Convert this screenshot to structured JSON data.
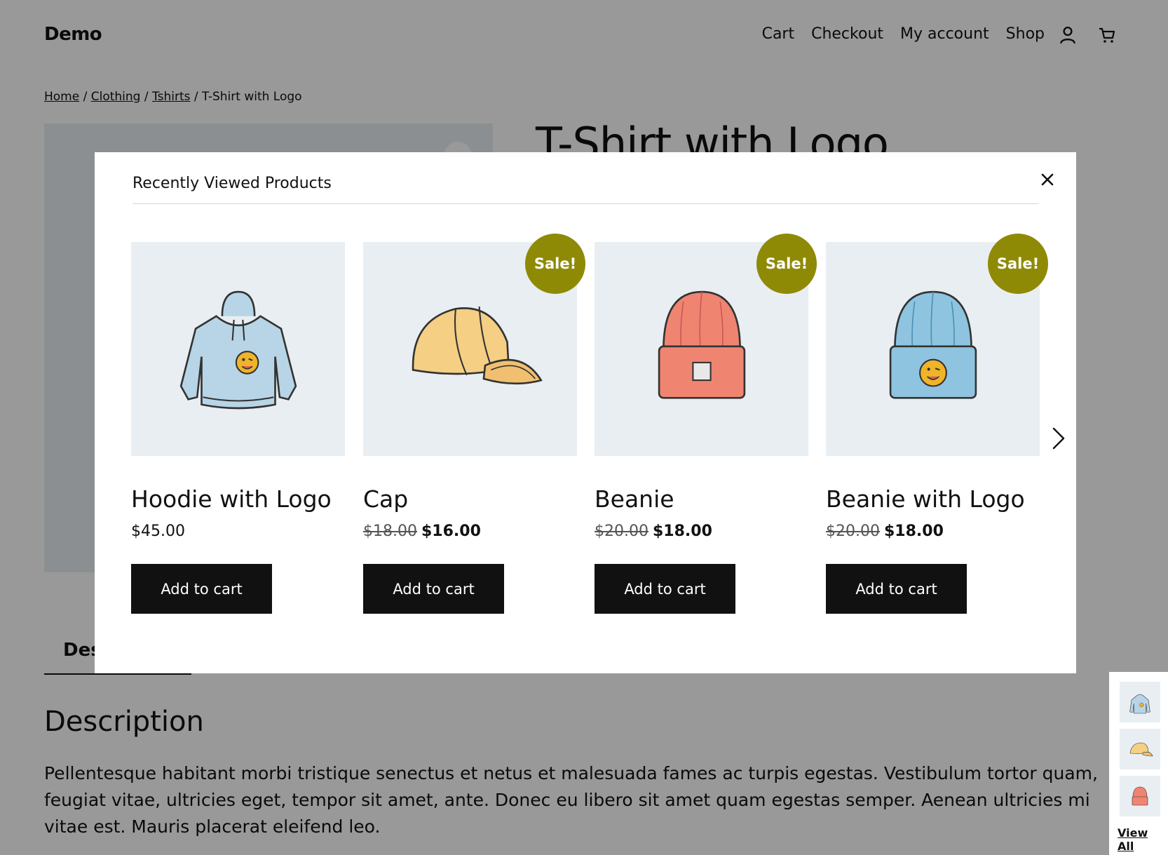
{
  "header": {
    "site_title": "Demo",
    "nav": [
      "Cart",
      "Checkout",
      "My account",
      "Shop"
    ],
    "icons": [
      "account-icon",
      "cart-icon"
    ]
  },
  "breadcrumb": {
    "links": [
      "Home",
      "Clothing",
      "Tshirts"
    ],
    "separator": "/",
    "current": "T-Shirt with Logo"
  },
  "product": {
    "title": "T-Shirt with Logo"
  },
  "tabs": {
    "active_label": "Des"
  },
  "description": {
    "heading": "Description",
    "text": "Pellentesque habitant morbi tristique senectus et netus et malesuada fames ac turpis egestas. Vestibulum tortor quam, feugiat vitae, ultricies eget, tempor sit amet, ante. Donec eu libero sit amet quam egestas semper. Aenean ultricies mi vitae est. Mauris placerat eleifend leo."
  },
  "modal": {
    "title": "Recently Viewed Products",
    "close_icon": "close-icon",
    "next_icon": "chevron-right-icon",
    "products": [
      {
        "name": "Hoodie with Logo",
        "price": "$45.00",
        "old_price": "",
        "sale": false,
        "badge": "",
        "button": "Add to cart",
        "image": "hoodie"
      },
      {
        "name": "Cap",
        "price": "$16.00",
        "old_price": "$18.00",
        "sale": true,
        "badge": "Sale!",
        "button": "Add to cart",
        "image": "cap"
      },
      {
        "name": "Beanie",
        "price": "$18.00",
        "old_price": "$20.00",
        "sale": true,
        "badge": "Sale!",
        "button": "Add to cart",
        "image": "beanie-red"
      },
      {
        "name": "Beanie with Logo",
        "price": "$18.00",
        "old_price": "$20.00",
        "sale": true,
        "badge": "Sale!",
        "button": "Add to cart",
        "image": "beanie-blue"
      }
    ]
  },
  "side_widget": {
    "link": "View All",
    "thumbs": [
      "hoodie",
      "cap",
      "beanie-red"
    ]
  },
  "colors": {
    "sale_badge": "#8f8a06",
    "button": "#111111",
    "image_bg": "#e9eef2",
    "overlay": "rgba(0,0,0,0.40)"
  }
}
